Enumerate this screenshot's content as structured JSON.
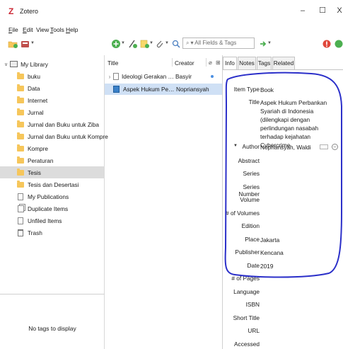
{
  "window": {
    "title": "Zotero",
    "logo": "Z",
    "minimize": "–",
    "maximize": "☐",
    "close": "X"
  },
  "menu": [
    {
      "label": "File",
      "key": "F"
    },
    {
      "label": "Edit",
      "key": "E"
    },
    {
      "label": "View",
      "key": ""
    },
    {
      "label": "Tools",
      "key": "T"
    },
    {
      "label": "Help",
      "key": "H"
    }
  ],
  "toolbar": {
    "search_placeholder": "All Fields & Tags",
    "accent_green": "#4caf50",
    "accent_red": "#e0463a"
  },
  "collections": {
    "library": "My Library",
    "folders": [
      "buku",
      "Data",
      "Internet",
      "Jurnal",
      "Jurnal  dan Buku untuk Ziba",
      "Jurnal dan Buku untuk Kompre",
      "Kompre",
      "Peraturan",
      "Tesis",
      "Tesis dan Desertasi"
    ],
    "selected": "Tesis",
    "special": [
      "My Publications",
      "Duplicate Items",
      "Unfiled Items",
      "Trash"
    ]
  },
  "tag_selector": {
    "empty_text": "No tags to display"
  },
  "items": {
    "columns": {
      "title": "Title",
      "creator": "Creator"
    },
    "rows": [
      {
        "title": "Ideologi Gerakan Politi...",
        "creator": "Basyir",
        "type": "document",
        "selected": false
      },
      {
        "title": "Aspek Hukum Perban...",
        "creator": "Nopriansyah",
        "type": "book",
        "selected": true
      }
    ]
  },
  "tabs": [
    "Info",
    "Notes",
    "Tags",
    "Related"
  ],
  "active_tab": "Info",
  "info": {
    "item_type_label": "Item Type",
    "item_type": "Book",
    "title_label": "Title",
    "title": "Aspek Hukum Perbankan Syariah di Indonesia (dilengkapi dengan perlindungan nasabah terhadap kejahatan Cybercrime",
    "author_label": "Author",
    "author": "Nopriansyah, Waldi",
    "abstract_label": "Abstract",
    "series_label": "Series",
    "series_number_label": "Series Number",
    "volume_label": "Volume",
    "num_volumes_label": "# of Volumes",
    "edition_label": "Edition",
    "place_label": "Place",
    "place": "Jakarta",
    "publisher_label": "Publisher",
    "publisher": "Kencana",
    "date_label": "Date",
    "date": "2019",
    "pages_label": "# of Pages",
    "language_label": "Language",
    "isbn_label": "ISBN",
    "short_title_label": "Short Title",
    "url_label": "URL",
    "accessed_label": "Accessed"
  },
  "annotation": {
    "color": "#2b2fc9"
  }
}
